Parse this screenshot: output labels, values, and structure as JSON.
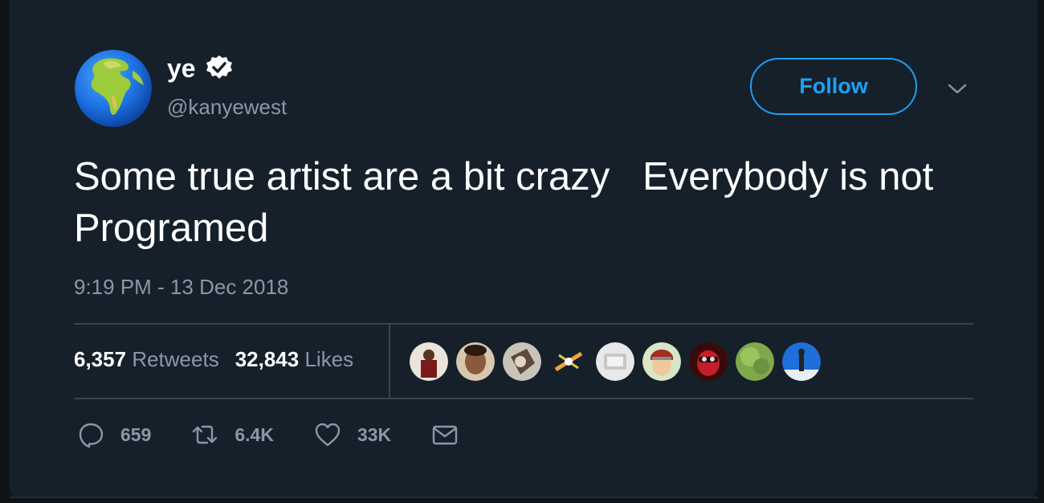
{
  "author": {
    "display_name": "ye",
    "handle": "@kanyewest",
    "avatar_icon": "globe-europe-africa-emoji",
    "verified": true
  },
  "header": {
    "follow_label": "Follow",
    "menu_icon": "chevron-down-icon"
  },
  "tweet": {
    "text": "Some true artist are a bit crazy   Everybody is not Programed",
    "timestamp": "9:19 PM - 13 Dec 2018"
  },
  "stats": {
    "retweets_count": "6,357",
    "retweets_label": "Retweets",
    "likes_count": "32,843",
    "likes_label": "Likes"
  },
  "actions": {
    "reply_count": "659",
    "retweet_count": "6.4K",
    "like_count": "33K"
  },
  "colors": {
    "background": "#15202b",
    "accent": "#1da1f2",
    "secondary_text": "#8899a6",
    "divider": "#38444d"
  }
}
